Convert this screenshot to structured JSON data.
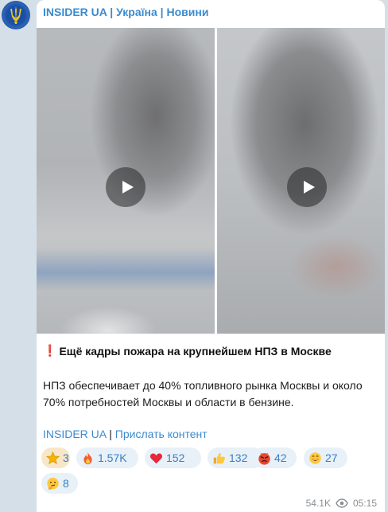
{
  "channel": {
    "name": "INSIDER UA",
    "separator1": " | ",
    "tag1": "Україна",
    "separator2": " | ",
    "tag2": "Новини",
    "avatar_icon": "trident-icon"
  },
  "post": {
    "headline_marker": "❗",
    "headline": "Ещё кадры пожара на крупнейшем НПЗ в Москве",
    "body": "НПЗ обеспечивает до 40% топливного рынка Москвы и около 70% потребностей Москвы и области в бензине.",
    "link_channel": "INSIDER UA",
    "link_separator": " | ",
    "link_submit": "Прислать контент",
    "videos": [
      {
        "icon": "play-icon"
      },
      {
        "icon": "play-icon"
      }
    ]
  },
  "reactions": [
    {
      "emoji": "star",
      "count": "3",
      "chosen": true
    },
    {
      "emoji": "fire",
      "count": "1.57K"
    },
    {
      "emoji": "heart",
      "count": "152"
    },
    {
      "emoji": "thumbs-up",
      "count": "132"
    },
    {
      "emoji": "enraged-face",
      "count": "42"
    },
    {
      "emoji": "grinning-face",
      "count": "27"
    },
    {
      "emoji": "thinking-face",
      "count": "8"
    }
  ],
  "meta": {
    "views": "54.1K",
    "time": "05:15"
  },
  "colors": {
    "background": "#d5dfe7",
    "accent": "#3a8bd0",
    "reaction_bg": "#e8f0f8"
  }
}
